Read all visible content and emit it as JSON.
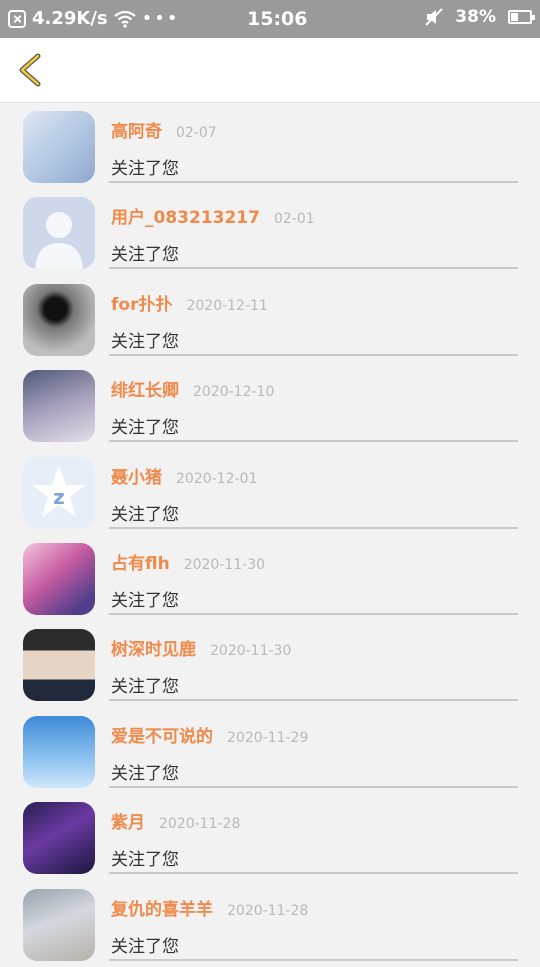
{
  "status_bar": {
    "speed": "4.29K/s",
    "dots": "•••",
    "time": "15:06",
    "battery_text": "38%",
    "battery_level": 0.38
  },
  "header": {
    "back_icon": "chevron-left-icon",
    "accent_color": "#f3c93a"
  },
  "items": [
    {
      "name": "高阿奇",
      "date": "02-07",
      "action": "关注了您",
      "avatar": "anime-girl-white-hair"
    },
    {
      "name": "用户_083213217",
      "date": "02-01",
      "action": "关注了您",
      "avatar": "default-person"
    },
    {
      "name": "for扑扑",
      "date": "2020-12-11",
      "action": "关注了您",
      "avatar": "black-rose"
    },
    {
      "name": "绯红长卿",
      "date": "2020-12-10",
      "action": "关注了您",
      "avatar": "anime-sleeping-girl"
    },
    {
      "name": "聂小猪",
      "date": "2020-12-01",
      "action": "关注了您",
      "avatar": "qzone-star"
    },
    {
      "name": "占有flh",
      "date": "2020-11-30",
      "action": "关注了您",
      "avatar": "anime-pink-hair"
    },
    {
      "name": "树深时见鹿",
      "date": "2020-11-30",
      "action": "关注了您",
      "avatar": "boy-black-hat"
    },
    {
      "name": "爱是不可说的",
      "date": "2020-11-29",
      "action": "关注了您",
      "avatar": "blue-sky"
    },
    {
      "name": "紫月",
      "date": "2020-11-28",
      "action": "关注了您",
      "avatar": "anime-purple-night"
    },
    {
      "name": "复仇的喜羊羊",
      "date": "2020-11-28",
      "action": "关注了您",
      "avatar": "anime-white-hair-boy"
    }
  ],
  "colors": {
    "name": "#f08a4b",
    "date": "#b9b9b9",
    "status_bar": "#9a9a9a",
    "background": "#f2f2f2"
  }
}
